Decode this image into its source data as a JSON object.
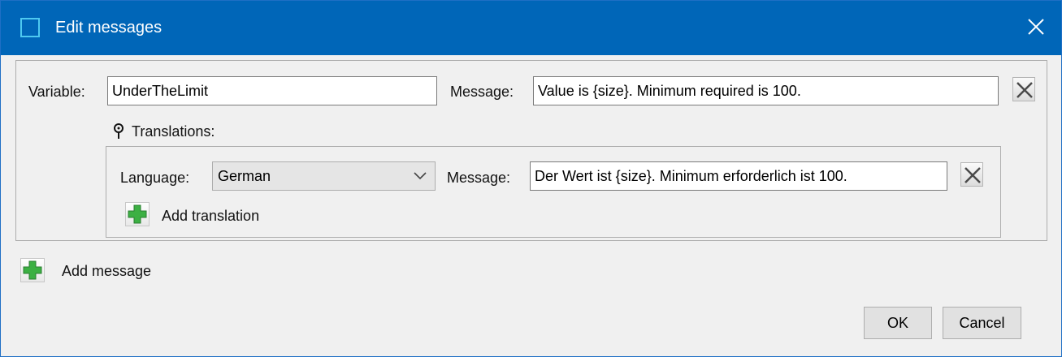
{
  "window": {
    "title": "Edit messages"
  },
  "message": {
    "variable_label": "Variable:",
    "variable_value": "UnderTheLimit",
    "message_label": "Message:",
    "message_value": "Value is {size}. Minimum required is 100."
  },
  "translations": {
    "label": "Translations:",
    "items": [
      {
        "language_label": "Language:",
        "language_value": "German",
        "message_label": "Message:",
        "message_value": "Der Wert ist {size}. Minimum erforderlich ist 100."
      }
    ],
    "add_label": "Add translation"
  },
  "add_message_label": "Add message",
  "buttons": {
    "ok": "OK",
    "cancel": "Cancel"
  },
  "colors": {
    "titlebar": "#0066b8",
    "accent_plus": "#3cb043",
    "remove_x": "#4a4a4a"
  },
  "icons": {
    "app": "app-window-icon",
    "close": "close-icon",
    "remove": "remove-x-icon",
    "pin": "pin-icon",
    "add": "green-plus-icon",
    "dropdown": "chevron-down-icon"
  }
}
